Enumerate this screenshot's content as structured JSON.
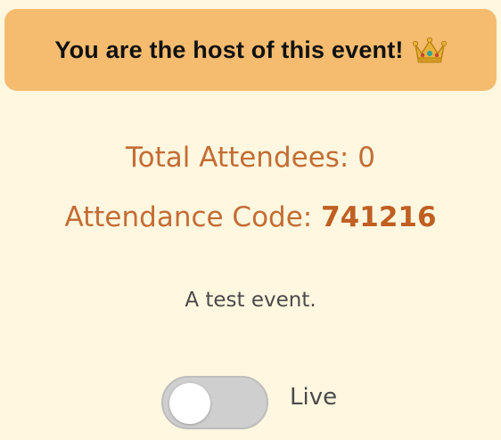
{
  "banner": {
    "text": "You are the host of this event!",
    "icon": "crown-icon"
  },
  "stats": {
    "total_attendees": "Total Attendees: 0",
    "attendance_code_label": "Attendance Code: ",
    "attendance_code_value": "741216"
  },
  "event": {
    "description": "A test event."
  },
  "live_toggle": {
    "label": "Live",
    "is_on": false
  },
  "colors": {
    "background": "#fff7df",
    "banner": "#f5bc70",
    "accent_text": "#c36d35",
    "body_text": "#4a4a4a",
    "toggle_off": "#cfcfcf"
  }
}
